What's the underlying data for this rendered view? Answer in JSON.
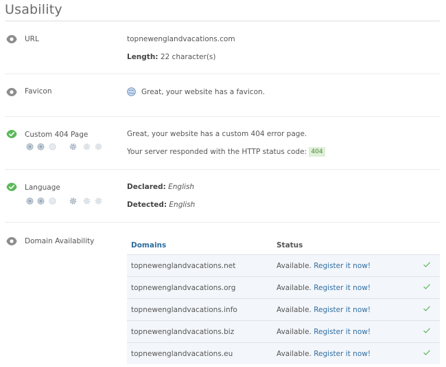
{
  "section": {
    "title": "Usability"
  },
  "url": {
    "label": "URL",
    "value": "topnewenglandvacations.com",
    "length_label": "Length:",
    "length_value": "22 character(s)"
  },
  "favicon": {
    "label": "Favicon",
    "message": "Great, your website has a favicon."
  },
  "custom404": {
    "label": "Custom 404 Page",
    "message": "Great, your website has a custom 404 error page.",
    "http_text": "Your server responded with the HTTP status code:",
    "http_code": "404"
  },
  "language": {
    "label": "Language",
    "declared_label": "Declared:",
    "declared_value": "English",
    "detected_label": "Detected:",
    "detected_value": "English"
  },
  "domain": {
    "label": "Domain Availability",
    "col_domains": "Domains",
    "col_status": "Status",
    "rows": [
      {
        "domain": "topnewenglandvacations.net",
        "status": "Available.",
        "link": "Register it now!"
      },
      {
        "domain": "topnewenglandvacations.org",
        "status": "Available.",
        "link": "Register it now!"
      },
      {
        "domain": "topnewenglandvacations.info",
        "status": "Available.",
        "link": "Register it now!"
      },
      {
        "domain": "topnewenglandvacations.biz",
        "status": "Available.",
        "link": "Register it now!"
      },
      {
        "domain": "topnewenglandvacations.eu",
        "status": "Available.",
        "link": "Register it now!"
      }
    ]
  },
  "colors": {
    "neutral_icon": "#8d8d8d",
    "success_icon": "#5cb85c",
    "link": "#2f6ea3",
    "table_header": "#2e6d9e",
    "check": "#5cb85c"
  },
  "icons": {
    "neutral": "eye-icon",
    "success": "checkmark-icon",
    "favicon": "globe-icon",
    "importance": "priority-dot-icon",
    "difficulty": "gear-icon",
    "available": "check-icon"
  }
}
